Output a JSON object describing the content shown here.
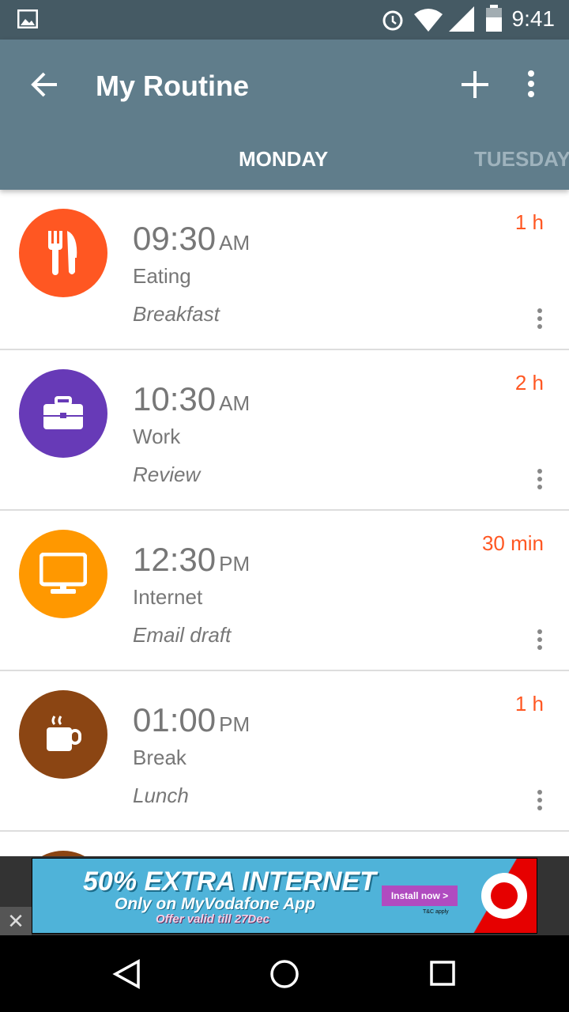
{
  "status_bar": {
    "time": "9:41"
  },
  "app_bar": {
    "title": "My Routine",
    "tabs": [
      {
        "label": "MONDAY",
        "active": true
      },
      {
        "label": "TUESDAY",
        "active": false
      }
    ]
  },
  "routine": [
    {
      "time": "09:30",
      "period": "AM",
      "category": "Eating",
      "note": "Breakfast",
      "duration": "1 h",
      "color": "#ff5722",
      "icon": "fork-knife-icon"
    },
    {
      "time": "10:30",
      "period": "AM",
      "category": "Work",
      "note": "Review",
      "duration": "2 h",
      "color": "#673ab7",
      "icon": "briefcase-icon"
    },
    {
      "time": "12:30",
      "period": "PM",
      "category": "Internet",
      "note": "Email draft",
      "duration": "30 min",
      "color": "#ff9800",
      "icon": "monitor-icon"
    },
    {
      "time": "01:00",
      "period": "PM",
      "category": "Break",
      "note": "Lunch",
      "duration": "1 h",
      "color": "#8b4513",
      "icon": "coffee-cup-icon"
    }
  ],
  "ad": {
    "headline": "50% EXTRA INTERNET",
    "line2": "Only on MyVodafone App",
    "line3": "Offer valid till 27Dec",
    "cta": "Install now >",
    "fine_print": "T&C apply"
  }
}
